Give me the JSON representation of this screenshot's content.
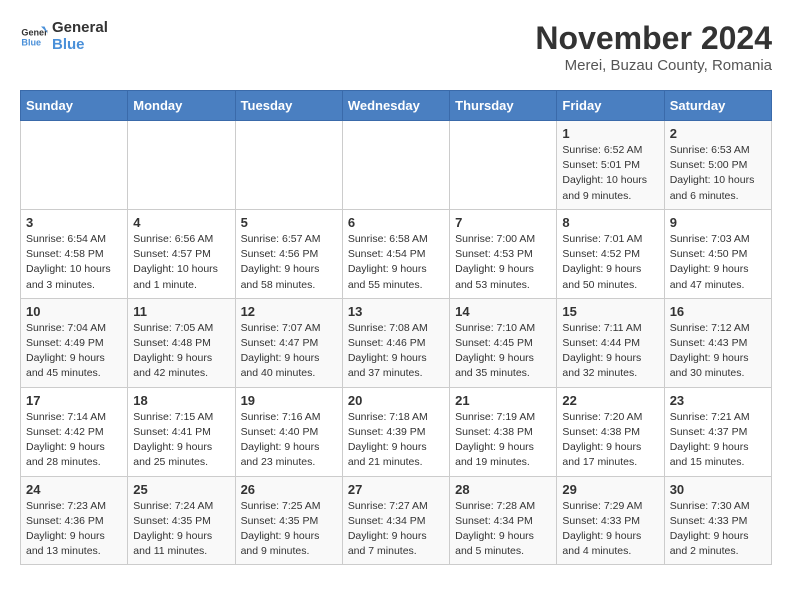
{
  "header": {
    "logo_general": "General",
    "logo_blue": "Blue",
    "title": "November 2024",
    "subtitle": "Merei, Buzau County, Romania"
  },
  "weekdays": [
    "Sunday",
    "Monday",
    "Tuesday",
    "Wednesday",
    "Thursday",
    "Friday",
    "Saturday"
  ],
  "weeks": [
    [
      {
        "day": "",
        "info": ""
      },
      {
        "day": "",
        "info": ""
      },
      {
        "day": "",
        "info": ""
      },
      {
        "day": "",
        "info": ""
      },
      {
        "day": "",
        "info": ""
      },
      {
        "day": "1",
        "info": "Sunrise: 6:52 AM\nSunset: 5:01 PM\nDaylight: 10 hours and 9 minutes."
      },
      {
        "day": "2",
        "info": "Sunrise: 6:53 AM\nSunset: 5:00 PM\nDaylight: 10 hours and 6 minutes."
      }
    ],
    [
      {
        "day": "3",
        "info": "Sunrise: 6:54 AM\nSunset: 4:58 PM\nDaylight: 10 hours and 3 minutes."
      },
      {
        "day": "4",
        "info": "Sunrise: 6:56 AM\nSunset: 4:57 PM\nDaylight: 10 hours and 1 minute."
      },
      {
        "day": "5",
        "info": "Sunrise: 6:57 AM\nSunset: 4:56 PM\nDaylight: 9 hours and 58 minutes."
      },
      {
        "day": "6",
        "info": "Sunrise: 6:58 AM\nSunset: 4:54 PM\nDaylight: 9 hours and 55 minutes."
      },
      {
        "day": "7",
        "info": "Sunrise: 7:00 AM\nSunset: 4:53 PM\nDaylight: 9 hours and 53 minutes."
      },
      {
        "day": "8",
        "info": "Sunrise: 7:01 AM\nSunset: 4:52 PM\nDaylight: 9 hours and 50 minutes."
      },
      {
        "day": "9",
        "info": "Sunrise: 7:03 AM\nSunset: 4:50 PM\nDaylight: 9 hours and 47 minutes."
      }
    ],
    [
      {
        "day": "10",
        "info": "Sunrise: 7:04 AM\nSunset: 4:49 PM\nDaylight: 9 hours and 45 minutes."
      },
      {
        "day": "11",
        "info": "Sunrise: 7:05 AM\nSunset: 4:48 PM\nDaylight: 9 hours and 42 minutes."
      },
      {
        "day": "12",
        "info": "Sunrise: 7:07 AM\nSunset: 4:47 PM\nDaylight: 9 hours and 40 minutes."
      },
      {
        "day": "13",
        "info": "Sunrise: 7:08 AM\nSunset: 4:46 PM\nDaylight: 9 hours and 37 minutes."
      },
      {
        "day": "14",
        "info": "Sunrise: 7:10 AM\nSunset: 4:45 PM\nDaylight: 9 hours and 35 minutes."
      },
      {
        "day": "15",
        "info": "Sunrise: 7:11 AM\nSunset: 4:44 PM\nDaylight: 9 hours and 32 minutes."
      },
      {
        "day": "16",
        "info": "Sunrise: 7:12 AM\nSunset: 4:43 PM\nDaylight: 9 hours and 30 minutes."
      }
    ],
    [
      {
        "day": "17",
        "info": "Sunrise: 7:14 AM\nSunset: 4:42 PM\nDaylight: 9 hours and 28 minutes."
      },
      {
        "day": "18",
        "info": "Sunrise: 7:15 AM\nSunset: 4:41 PM\nDaylight: 9 hours and 25 minutes."
      },
      {
        "day": "19",
        "info": "Sunrise: 7:16 AM\nSunset: 4:40 PM\nDaylight: 9 hours and 23 minutes."
      },
      {
        "day": "20",
        "info": "Sunrise: 7:18 AM\nSunset: 4:39 PM\nDaylight: 9 hours and 21 minutes."
      },
      {
        "day": "21",
        "info": "Sunrise: 7:19 AM\nSunset: 4:38 PM\nDaylight: 9 hours and 19 minutes."
      },
      {
        "day": "22",
        "info": "Sunrise: 7:20 AM\nSunset: 4:38 PM\nDaylight: 9 hours and 17 minutes."
      },
      {
        "day": "23",
        "info": "Sunrise: 7:21 AM\nSunset: 4:37 PM\nDaylight: 9 hours and 15 minutes."
      }
    ],
    [
      {
        "day": "24",
        "info": "Sunrise: 7:23 AM\nSunset: 4:36 PM\nDaylight: 9 hours and 13 minutes."
      },
      {
        "day": "25",
        "info": "Sunrise: 7:24 AM\nSunset: 4:35 PM\nDaylight: 9 hours and 11 minutes."
      },
      {
        "day": "26",
        "info": "Sunrise: 7:25 AM\nSunset: 4:35 PM\nDaylight: 9 hours and 9 minutes."
      },
      {
        "day": "27",
        "info": "Sunrise: 7:27 AM\nSunset: 4:34 PM\nDaylight: 9 hours and 7 minutes."
      },
      {
        "day": "28",
        "info": "Sunrise: 7:28 AM\nSunset: 4:34 PM\nDaylight: 9 hours and 5 minutes."
      },
      {
        "day": "29",
        "info": "Sunrise: 7:29 AM\nSunset: 4:33 PM\nDaylight: 9 hours and 4 minutes."
      },
      {
        "day": "30",
        "info": "Sunrise: 7:30 AM\nSunset: 4:33 PM\nDaylight: 9 hours and 2 minutes."
      }
    ]
  ]
}
